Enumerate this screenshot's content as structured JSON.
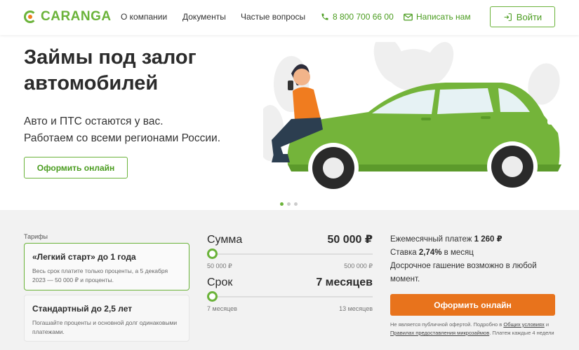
{
  "header": {
    "logo": "CARANGA",
    "nav": [
      "О компании",
      "Документы",
      "Частые вопросы"
    ],
    "phone": "8 800 700 66 00",
    "write": "Написать нам",
    "login": "Войти"
  },
  "hero": {
    "title": "Займы под залог автомобилей",
    "subtitle_line1": "Авто и ПТС остаются у вас.",
    "subtitle_line2": "Работаем со всеми регионами России.",
    "cta": "Оформить онлайн",
    "slides_total": 3,
    "slide_active": 1
  },
  "tariffs": {
    "label": "Тарифы",
    "items": [
      {
        "title": "«Легкий старт» до 1 года",
        "desc": "Весь срок платите только проценты, а 5 декабря 2023 — 50 000 ₽ и проценты."
      },
      {
        "title": "Стандартный до 2,5 лет",
        "desc": "Погашайте проценты и основной долг одинаковыми платежами."
      }
    ]
  },
  "calculator": {
    "sum": {
      "label": "Сумма",
      "value": "50 000 ₽",
      "min": "50 000 ₽",
      "max": "500 000 ₽",
      "fraction": 0
    },
    "term": {
      "label": "Срок",
      "value": "7 месяцев",
      "min": "7 месяцев",
      "max": "13 месяцев",
      "fraction": 0
    }
  },
  "summary": {
    "monthly_label": "Ежемесячный платеж",
    "monthly_value": "1 260 ₽",
    "rate_label": "Ставка",
    "rate_value": "2,74%",
    "rate_suffix": "в месяц",
    "early": "Досрочное гашение возможно в любой момент.",
    "cta": "Оформить онлайн",
    "disclaimer_a": "Не является публичной офертой. Подробно в",
    "disclaimer_link1": "Общих условиях",
    "disclaimer_b": "и",
    "disclaimer_link2": "Правилах предоставления микрозаймов",
    "disclaimer_c": ". Платеж каждые 4 недели"
  },
  "colors": {
    "green": "#6bb33a",
    "orange": "#e8731c"
  }
}
